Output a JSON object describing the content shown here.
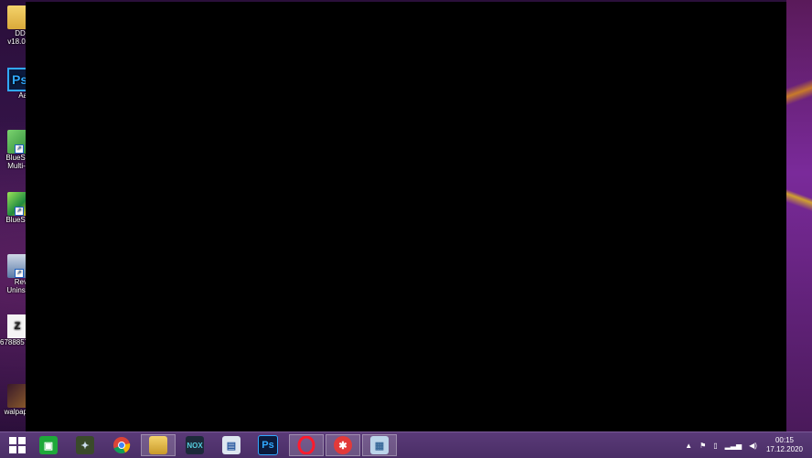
{
  "desktop": {
    "icons": [
      {
        "line1": "DDI",
        "line2": "v18.0.",
        "kind": "folder"
      },
      {
        "line1": "Aa",
        "line2": "",
        "kind": "photoshop"
      },
      {
        "line1": "BlueSt",
        "line2": "Multi-I",
        "kind": "bluestacks-multi"
      },
      {
        "line1": "BlueSt",
        "line2": "",
        "kind": "bluestacks"
      },
      {
        "line1": "Rev",
        "line2": "Uninst",
        "kind": "revo"
      },
      {
        "line1": "6788857",
        "line2": "",
        "kind": "document"
      },
      {
        "line1": "walpap",
        "line2": "",
        "kind": "wallpaper"
      }
    ]
  },
  "taskbar": {
    "apps": [
      {
        "name": "start-icon",
        "label": ""
      },
      {
        "name": "store-icon",
        "label": ""
      },
      {
        "name": "game-icon",
        "label": ""
      },
      {
        "name": "chrome-icon",
        "label": ""
      },
      {
        "name": "file-explorer-icon",
        "label": ""
      },
      {
        "name": "nox-icon",
        "label": ""
      },
      {
        "name": "network-app-icon",
        "label": ""
      },
      {
        "name": "photoshop-icon",
        "label": "Ps"
      },
      {
        "name": "opera-icon",
        "label": ""
      },
      {
        "name": "red-app-icon",
        "label": ""
      },
      {
        "name": "image-viewer-icon",
        "label": ""
      }
    ],
    "tray": {
      "time": "00:15",
      "date": "17.12.2020"
    }
  },
  "colors": {
    "window": "#000000",
    "taskbar": "#4a2e66",
    "ps_accent": "#31a8ff"
  }
}
